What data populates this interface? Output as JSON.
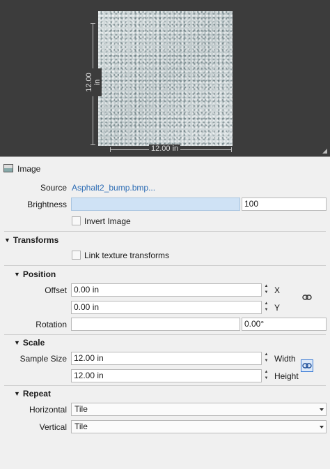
{
  "preview": {
    "height_label": "12.00 in",
    "width_label": "12.00 in"
  },
  "image_section": {
    "title": "Image",
    "source_label": "Source",
    "source_value": "Asphalt2_bump.bmp...",
    "brightness_label": "Brightness",
    "brightness_value": "100",
    "invert_label": "Invert Image"
  },
  "transforms": {
    "title": "Transforms",
    "link_label": "Link texture transforms"
  },
  "position": {
    "title": "Position",
    "offset_label": "Offset",
    "offset_x": "0.00 in",
    "offset_x_axis": "X",
    "offset_y": "0.00 in",
    "offset_y_axis": "Y",
    "rotation_label": "Rotation",
    "rotation_value": "0.00°"
  },
  "scale": {
    "title": "Scale",
    "sample_label": "Sample Size",
    "width_value": "12.00 in",
    "width_label": "Width",
    "height_value": "12.00 in",
    "height_label": "Height"
  },
  "repeat": {
    "title": "Repeat",
    "horizontal_label": "Horizontal",
    "horizontal_value": "Tile",
    "vertical_label": "Vertical",
    "vertical_value": "Tile"
  },
  "colors": {
    "preview_bg": "#3c3c3c",
    "panel_bg": "#f0f0f0",
    "link": "#2f6eb5",
    "slider_fill": "#cfe2f5",
    "link_active": "#3a7bd5"
  },
  "icons": {
    "image": "image-icon",
    "chain": "chain-link-icon",
    "collapse": "triangle-down-icon",
    "spinner": "spinner-arrows-icon",
    "dropdown": "chevron-down-icon",
    "resize": "resize-grip-icon"
  }
}
